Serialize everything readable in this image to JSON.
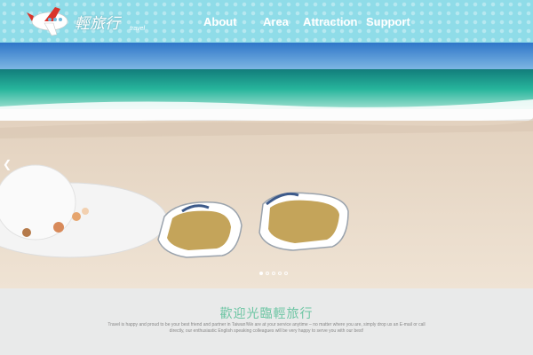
{
  "header": {
    "logo_text": "輕旅行",
    "logo_sub": "travel",
    "nav": [
      {
        "label": "About"
      },
      {
        "label": "Area"
      },
      {
        "label": "Attraction"
      },
      {
        "label": "Support"
      }
    ]
  },
  "hero": {
    "slide_count": 5,
    "active_slide": 1
  },
  "welcome": {
    "title": "歡迎光臨輕旅行",
    "body": "Travel is happy and proud to be your best friend and partner in Taiwan!We are at your service anytime – no matter where you are, simply drop us an E-mail or call directly, our enthusiastic English speaking colleagues will be very happy to serve you with our best!"
  },
  "colors": {
    "nav_bg": "#8fdce8",
    "accent_green": "#6cc5a3",
    "page_bg": "#e9eaea"
  }
}
